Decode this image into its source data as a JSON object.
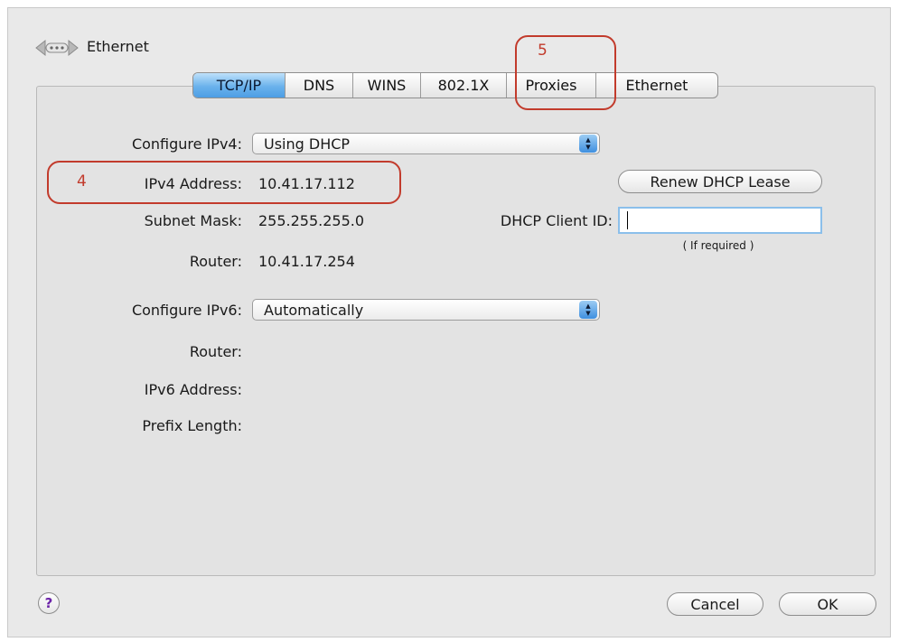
{
  "header": {
    "title": "Ethernet",
    "icon": "network-back-icon"
  },
  "tabs": [
    {
      "label": "TCP/IP",
      "active": true
    },
    {
      "label": "DNS",
      "active": false
    },
    {
      "label": "WINS",
      "active": false
    },
    {
      "label": "802.1X",
      "active": false
    },
    {
      "label": "Proxies",
      "active": false
    },
    {
      "label": "Ethernet",
      "active": false
    }
  ],
  "ipv4": {
    "configure_label": "Configure IPv4:",
    "configure_value": "Using DHCP",
    "address_label": "IPv4 Address:",
    "address_value": "10.41.17.112",
    "subnet_label": "Subnet Mask:",
    "subnet_value": "255.255.255.0",
    "router_label": "Router:",
    "router_value": "10.41.17.254"
  },
  "dhcp": {
    "renew_label": "Renew DHCP Lease",
    "client_id_label": "DHCP Client ID:",
    "client_id_value": "",
    "client_id_hint": "( If required )"
  },
  "ipv6": {
    "configure_label": "Configure IPv6:",
    "configure_value": "Automatically",
    "router_label": "Router:",
    "address_label": "IPv6 Address:",
    "prefix_label": "Prefix Length:"
  },
  "footer": {
    "help_label": "?",
    "cancel_label": "Cancel",
    "ok_label": "OK"
  },
  "annotations": [
    {
      "number": "4"
    },
    {
      "number": "5"
    }
  ],
  "colors": {
    "accent": "#4d9ee4",
    "annotation": "#c23b2c",
    "panel": "#e3e3e3"
  }
}
